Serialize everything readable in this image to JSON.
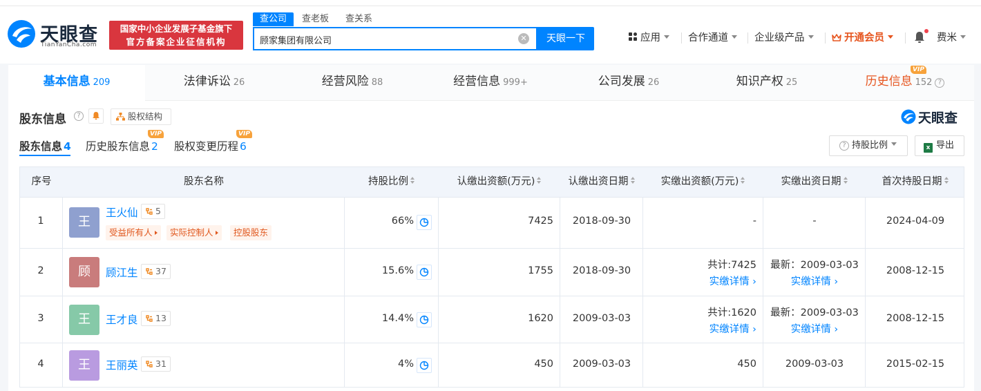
{
  "header": {
    "logo_cn": "天眼查",
    "logo_en": "TianYanCha.com",
    "badge_line1": "国家中小企业发展子基金旗下",
    "badge_line2": "官方备案企业征信机构",
    "search_tabs": [
      "查公司",
      "查老板",
      "查关系"
    ],
    "search_value": "顾家集团有限公司",
    "search_button": "天眼一下",
    "nav": {
      "apps": "应用",
      "channel": "合作通道",
      "enterprise": "企业级产品",
      "vip": "开通会员",
      "user": "费米"
    }
  },
  "main_tabs": [
    {
      "label": "基本信息",
      "count": "209"
    },
    {
      "label": "法律诉讼",
      "count": "26"
    },
    {
      "label": "经营风险",
      "count": "88"
    },
    {
      "label": "经营信息",
      "count": "999+"
    },
    {
      "label": "公司发展",
      "count": "26"
    },
    {
      "label": "知识产权",
      "count": "25"
    },
    {
      "label": "历史信息",
      "count": "152"
    }
  ],
  "vip_label": "VIP",
  "section": {
    "title": "股东信息",
    "structure_button": "股权结构",
    "brand": "天眼查",
    "sub_tabs": [
      {
        "label": "股东信息",
        "count": "4"
      },
      {
        "label": "历史股东信息",
        "count": "2"
      },
      {
        "label": "股权变更历程",
        "count": "6"
      }
    ],
    "ratio_button": "持股比例",
    "export_button": "导出",
    "excel_letter": "x"
  },
  "table": {
    "headers": [
      "序号",
      "股东名称",
      "持股比例",
      "认缴出资额(万元)",
      "认缴出资日期",
      "实缴出资额(万元)",
      "实缴出资日期",
      "首次持股日期"
    ],
    "rows": [
      {
        "index": "1",
        "avatar": "王",
        "avatar_color": "#8fa0cf",
        "name": "王火仙",
        "links": "5",
        "tags": [
          "受益所有人",
          "实际控制人",
          "控股股东"
        ],
        "ratio": "66%",
        "subscribed": "7425",
        "sub_date": "2018-09-30",
        "paid": "-",
        "paid_detail": "",
        "paid_date": "-",
        "paid_date_detail": "",
        "first_date": "2024-04-09"
      },
      {
        "index": "2",
        "avatar": "顾",
        "avatar_color": "#c97c7c",
        "name": "顾江生",
        "links": "37",
        "tags": [],
        "ratio": "15.6%",
        "subscribed": "1755",
        "sub_date": "2018-09-30",
        "paid": "共计:7425",
        "paid_detail": "实缴详情",
        "paid_date": "最新：2009-03-03",
        "paid_date_detail": "实缴详情",
        "first_date": "2008-12-15"
      },
      {
        "index": "3",
        "avatar": "王",
        "avatar_color": "#86c9a8",
        "name": "王才良",
        "links": "13",
        "tags": [],
        "ratio": "14.4%",
        "subscribed": "1620",
        "sub_date": "2009-03-03",
        "paid": "共计:1620",
        "paid_detail": "实缴详情",
        "paid_date": "最新：2009-03-03",
        "paid_date_detail": "实缴详情",
        "first_date": "2008-12-15"
      },
      {
        "index": "4",
        "avatar": "王",
        "avatar_color": "#b99be0",
        "name": "王丽英",
        "links": "31",
        "tags": [],
        "ratio": "4%",
        "subscribed": "450",
        "sub_date": "2009-03-03",
        "paid": "450",
        "paid_detail": "",
        "paid_date": "2009-03-03",
        "paid_date_detail": "",
        "first_date": "2015-02-15"
      }
    ]
  }
}
